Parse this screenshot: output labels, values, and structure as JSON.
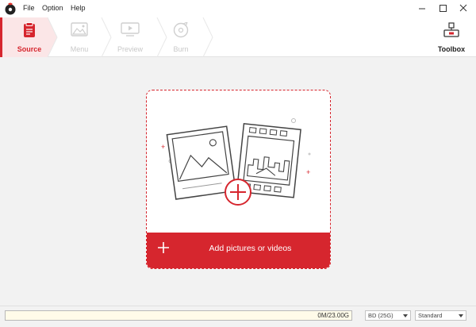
{
  "menu": {
    "items": [
      "File",
      "Option",
      "Help"
    ]
  },
  "steps": [
    {
      "label": "Source",
      "icon": "source-icon",
      "active": true
    },
    {
      "label": "Menu",
      "icon": "menu-template-icon",
      "active": false
    },
    {
      "label": "Preview",
      "icon": "preview-icon",
      "active": false
    },
    {
      "label": "Burn",
      "icon": "burn-disc-icon",
      "active": false
    }
  ],
  "toolbox": {
    "label": "Toolbox",
    "icon": "toolbox-icon"
  },
  "drop_area": {
    "add_label": "Add pictures or videos"
  },
  "status": {
    "capacity_text": "0M/23.00G",
    "disc_type": "BD (25G)",
    "quality": "Standard"
  },
  "colors": {
    "accent": "#d6262e",
    "background": "#f2f2f2"
  }
}
